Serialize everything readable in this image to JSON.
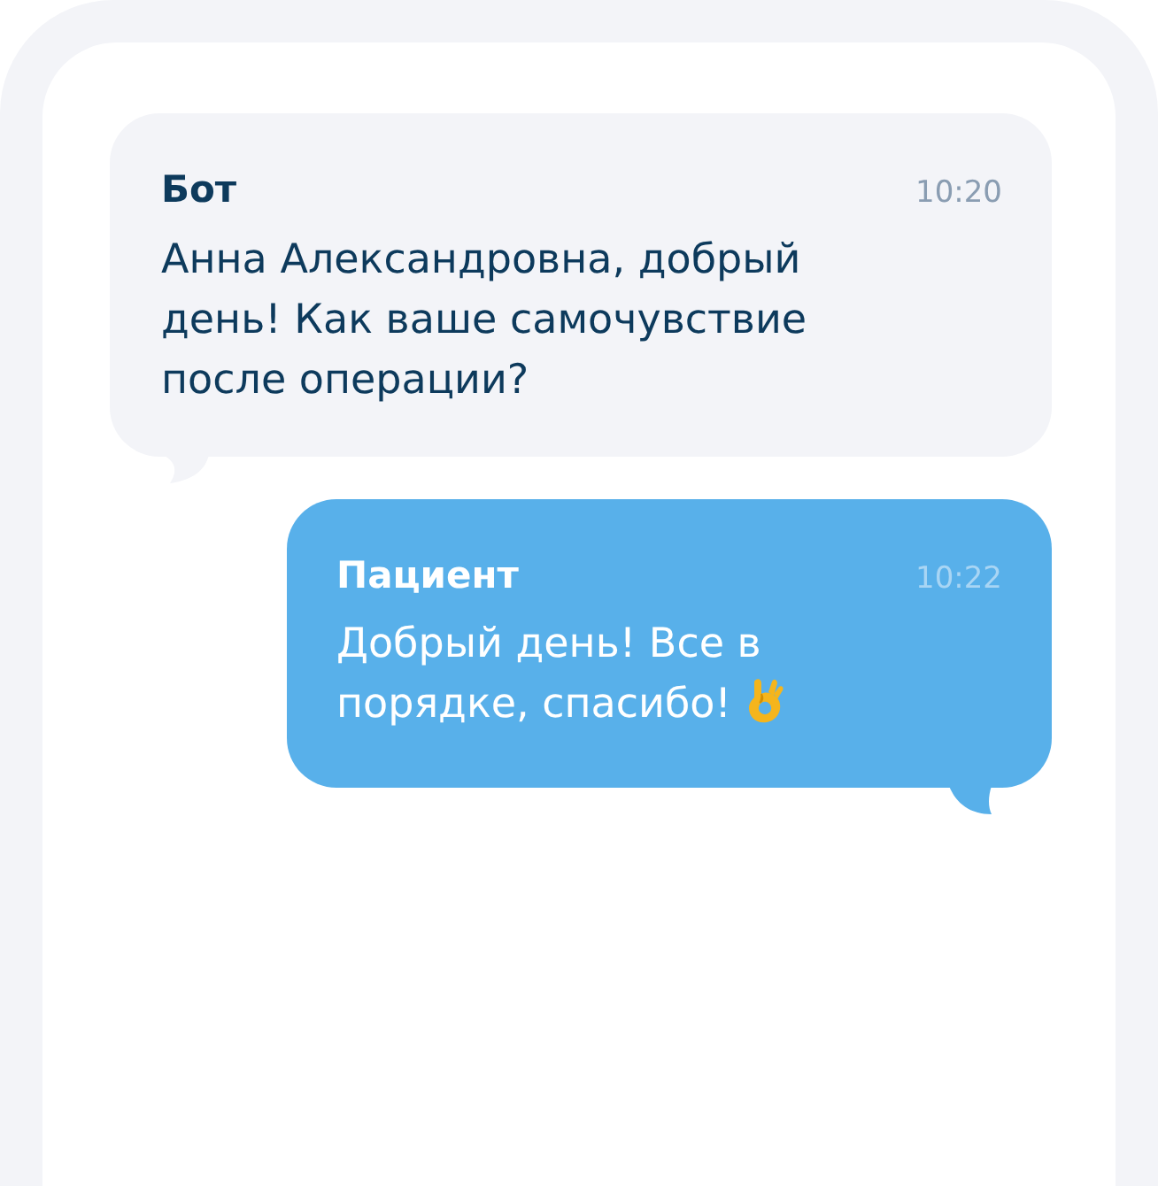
{
  "messages": [
    {
      "kind": "incoming",
      "sender": "Бот",
      "time": "10:20",
      "text": "Анна Александровна, добрый день! Как ваше самочувствие после операции?"
    },
    {
      "kind": "outgoing",
      "sender": "Пациент",
      "time": "10:22",
      "text": "Добрый день! Все в порядке, спасибо!"
    }
  ]
}
